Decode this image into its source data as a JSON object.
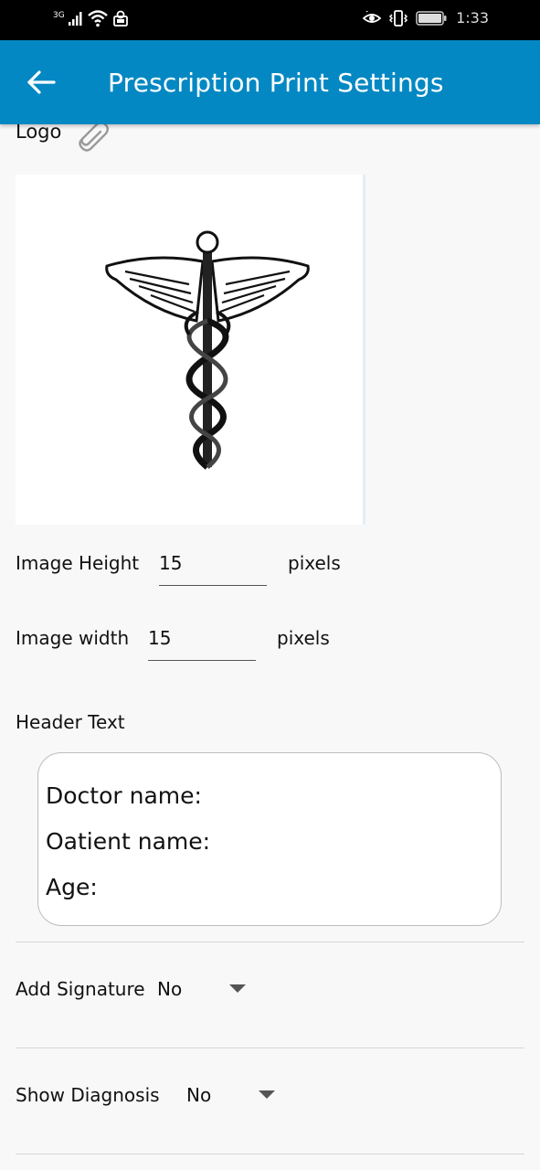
{
  "status_bar": {
    "network": "3G",
    "time": "1:33",
    "icons": [
      "signal-icon",
      "wifi-icon",
      "notification-icon",
      "eye-comfort-icon",
      "vibrate-icon",
      "battery-icon"
    ]
  },
  "app_bar": {
    "title": "Prescription Print Settings",
    "back_icon": "back-arrow-icon",
    "color": "#0488c3"
  },
  "logo": {
    "label": "Logo",
    "attach_icon": "paperclip-icon",
    "image_icon": "caduceus-icon"
  },
  "image_height": {
    "label": "Image Height",
    "value": "15",
    "unit": "pixels"
  },
  "image_width": {
    "label": "Image width",
    "value": "15",
    "unit": "pixels"
  },
  "header_text": {
    "label": "Header Text",
    "lines": [
      "Doctor name:",
      "Oatient name:",
      "Age:"
    ]
  },
  "add_signature": {
    "label": "Add Signature",
    "value": "No"
  },
  "show_diagnosis": {
    "label": "Show Diagnosis",
    "value": "No"
  }
}
